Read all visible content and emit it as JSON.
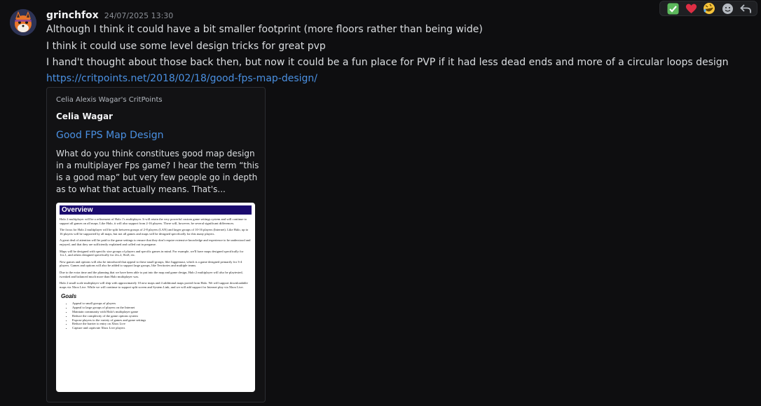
{
  "message": {
    "username": "grinchfox",
    "timestamp": "24/07/2025 13:30",
    "lines": [
      "Although I think it could have a bit smaller footprint (more floors rather than being wide)",
      "I think it could use some level design tricks for great pvp",
      "I hand't thought about those back then, but now it could be a fun place for PVP if it had less dead ends and more of a circular loops design"
    ],
    "link": "https://critpoints.net/2018/02/18/good-fps-map-design/"
  },
  "embed": {
    "provider": "Celia Alexis Wagar's CritPoints",
    "author": "Celia Wagar",
    "title": "Good FPS Map Design",
    "description": "What do you think constitues good map design in a multiplayer Fps game? I hear the term “this is a good map” but very few people go in depth as to what that actually means. That's...",
    "image": {
      "heading": "Overview",
      "paragraphs": [
        "Halo 2 multiplayer will be a refinement of Halo 1's multiplayer. It will retain the very powerful custom game settings system and will continue to support all games on all maps. Like Halo, it will also support from 2-16 players. There will, however, be several significant differences.",
        "The focus for Halo 2 multiplayer will be split between groups of 2-8 players (LAN) and larger groups of 10-16 players (Internet). Like Halo, up to 16 players will be supported by all maps, but not all games and maps will be designed specifically for this many players.",
        "A great deal of attention will be paid to the game settings to ensure that they don't require extensive knowledge and experience to be understood and enjoyed, and that they are sufficiently explained and called out in pregame.",
        "Maps will be designed with specific size groups of players and specific games in mind. For example, we'll have maps designed specifically for 1vs.1, and others designed specifically for 2vs.2, 8vs8, etc.",
        "New games and options will also be introduced that appeal to these small groups, like Juggernaut, which is a game designed primarily for 3-4 players. Games and options will also be added to support large groups, like Territories and multiple teams.",
        "Due to the extra time and the planning that we have been able to put into the map and game design, Halo 2 multiplayer will also be playtested, tweaked and balanced much more than Halo multiplayer was.",
        "Halo 2 small scale multiplayer will ship with approximately 10 new maps and 4 additional maps ported from Halo. We will support downloadable maps via Xbox Live. While we will continue to support split screen and System Link, and we will add support for Internet play via Xbox Live."
      ],
      "goals_title": "Goals",
      "goals": [
        "Appeal to small groups of players",
        "Appeal to large groups of players on the Internet",
        "Maintain community with Halo's multiplayer game",
        "Reduce the complexity of the game options system",
        "Expose players to the variety of games and game settings",
        "Reduce the barrier to entry on Xbox Live",
        "Capture and captivate Xbox Live players"
      ]
    }
  },
  "reactions": [
    {
      "icon": "check-mark-emoji",
      "glyph": "✅"
    },
    {
      "icon": "heart-emoji",
      "glyph": "❤️"
    },
    {
      "icon": "rofl-emoji",
      "glyph": "🤣"
    },
    {
      "icon": "add-reaction-icon"
    },
    {
      "icon": "reply-icon"
    }
  ],
  "colors": {
    "link": "#4a90e2",
    "doc_heading_bg": "#1a0a6e",
    "background": "#0e0e10"
  }
}
